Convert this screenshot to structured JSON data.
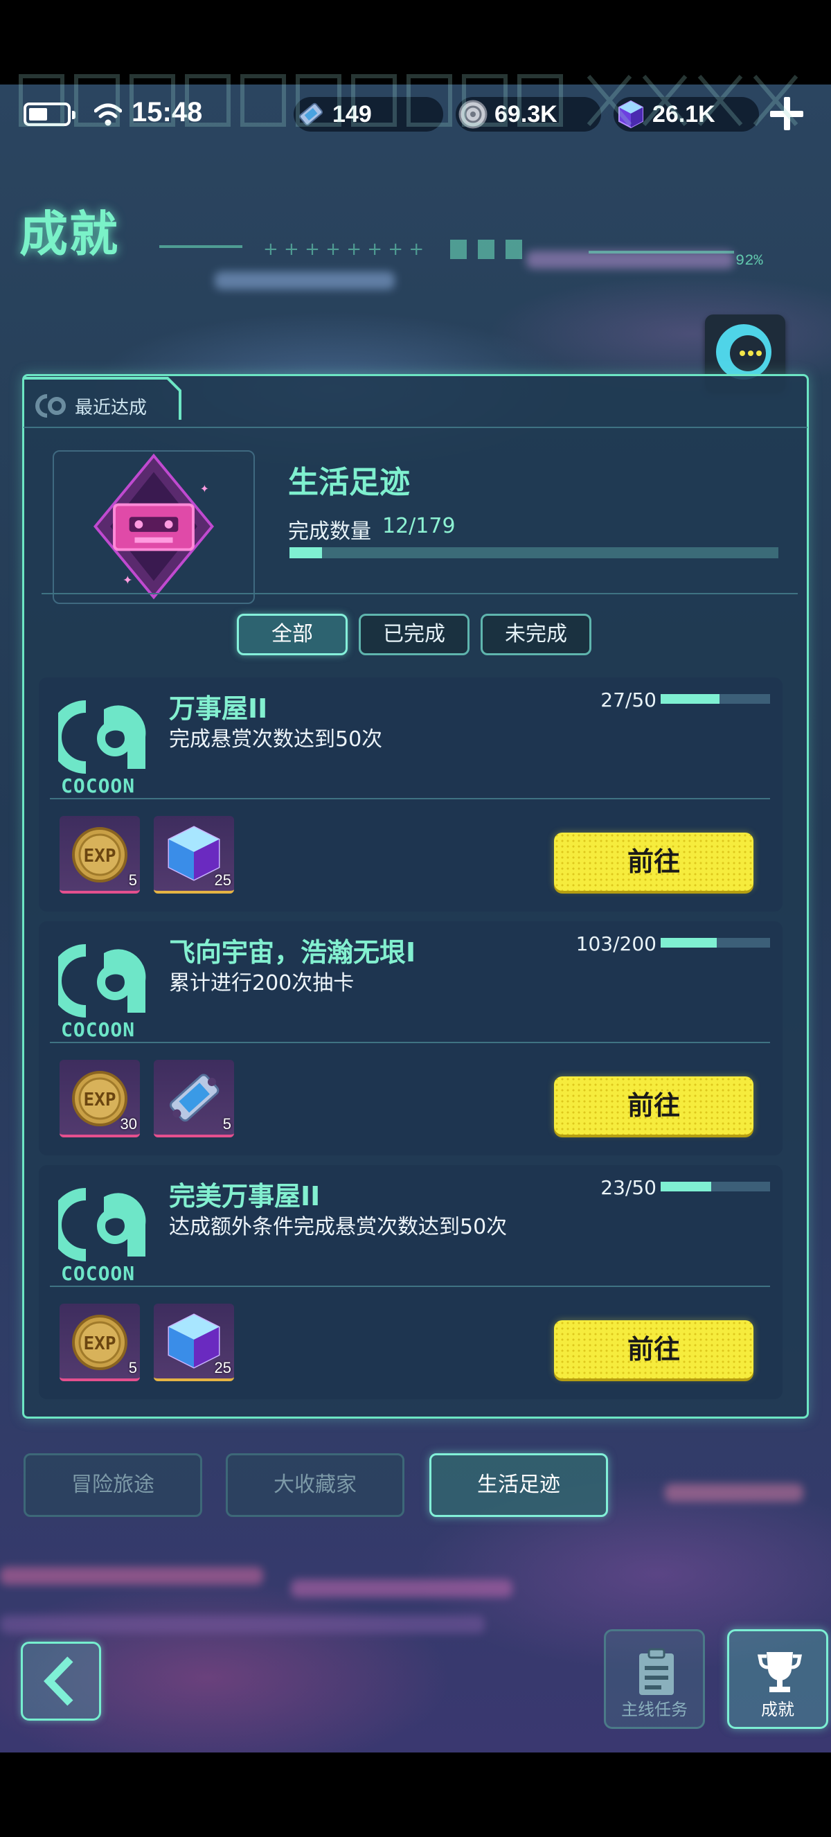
{
  "status_bar": {
    "time": "15:48",
    "currencies": [
      {
        "icon": "ticket-icon",
        "value": "149"
      },
      {
        "icon": "silver-coin-icon",
        "value": "69.3K"
      },
      {
        "icon": "crystal-cube-icon",
        "value": "26.1K"
      }
    ]
  },
  "header": {
    "title": "成就",
    "progress_text": "92%"
  },
  "recent": {
    "label": "最近达成",
    "name": "生活足迹",
    "count_label": "完成数量",
    "count_value": "12/179",
    "progress_fraction": 0.067
  },
  "filters": [
    {
      "label": "全部",
      "active": true
    },
    {
      "label": "已完成",
      "active": false
    },
    {
      "label": "未完成",
      "active": false
    }
  ],
  "achievements": [
    {
      "logo_text": "COCOON",
      "title": "万事屋II",
      "description": "完成悬赏次数达到50次",
      "progress_text": "27/50",
      "progress_fraction": 0.54,
      "rewards": [
        {
          "icon": "exp-coin-icon",
          "count": "5"
        },
        {
          "icon": "crystal-cube-icon",
          "count": "25"
        }
      ],
      "button": "前往"
    },
    {
      "logo_text": "COCOON",
      "title": "飞向宇宙，浩瀚无垠I",
      "description": "累计进行200次抽卡",
      "progress_text": "103/200",
      "progress_fraction": 0.515,
      "rewards": [
        {
          "icon": "exp-coin-icon",
          "count": "30"
        },
        {
          "icon": "ticket-icon",
          "count": "5"
        }
      ],
      "button": "前往"
    },
    {
      "logo_text": "COCOON",
      "title": "完美万事屋II",
      "description": "达成额外条件完成悬赏次数达到50次",
      "progress_text": "23/50",
      "progress_fraction": 0.46,
      "rewards": [
        {
          "icon": "exp-coin-icon",
          "count": "5"
        },
        {
          "icon": "crystal-cube-icon",
          "count": "25"
        }
      ],
      "button": "前往"
    }
  ],
  "categories": [
    {
      "label": "冒险旅途",
      "active": false
    },
    {
      "label": "大收藏家",
      "active": false
    },
    {
      "label": "生活足迹",
      "active": true
    }
  ],
  "bottom_nav": {
    "main_quest": "主线任务",
    "achievements": "成就"
  },
  "colors": {
    "accent": "#7ff0d2",
    "button_yellow": "#f6ec3d",
    "panel_border": "#6de6c4"
  }
}
